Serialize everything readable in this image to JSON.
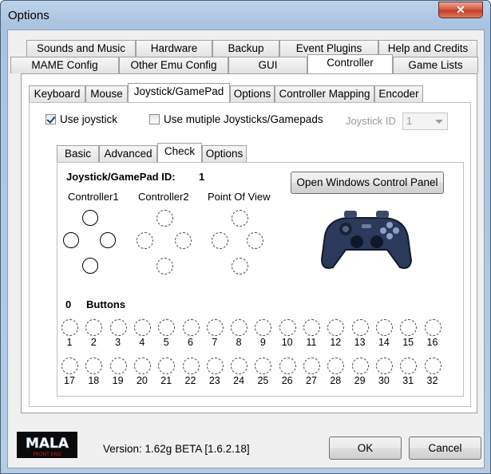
{
  "window": {
    "title": "Options",
    "close_glyph": "✕"
  },
  "top_tabs_row1": [
    "Sounds and Music",
    "Hardware",
    "Backup",
    "Event Plugins",
    "Help and Credits"
  ],
  "top_tabs_row2": [
    "MAME Config",
    "Other Emu Config",
    "GUI",
    "Controller",
    "Game Lists"
  ],
  "active_top_tab": "Controller",
  "sub_tabs": [
    "Keyboard",
    "Mouse",
    "Joystick/GamePad",
    "Options",
    "Controller Mapping",
    "Encoder"
  ],
  "active_sub_tab": "Joystick/GamePad",
  "use_joystick": {
    "label": "Use joystick",
    "checked": true
  },
  "use_multiple": {
    "label": "Use mutiple Joysticks/Gamepads",
    "checked": false
  },
  "joystick_id": {
    "label": "Joystick ID",
    "value": "1"
  },
  "inner_tabs": [
    "Basic",
    "Advanced",
    "Check",
    "Options"
  ],
  "active_inner_tab": "Check",
  "check": {
    "id_label": "Joystick/GamePad ID:",
    "id_value": "1",
    "open_panel_button": "Open Windows Control Panel",
    "controller1": "Controller1",
    "controller2": "Controller2",
    "pov": "Point Of View",
    "button_count": "0",
    "buttons_label": "Buttons",
    "button_numbers": [
      "1",
      "2",
      "3",
      "4",
      "5",
      "6",
      "7",
      "8",
      "9",
      "10",
      "11",
      "12",
      "13",
      "14",
      "15",
      "16",
      "17",
      "18",
      "19",
      "20",
      "21",
      "22",
      "23",
      "24",
      "25",
      "26",
      "27",
      "28",
      "29",
      "30",
      "31",
      "32"
    ]
  },
  "footer": {
    "logo_text": "MALA",
    "logo_subtext": "FRONT END",
    "version": "Version: 1.62g BETA [1.6.2.18]",
    "ok": "OK",
    "cancel": "Cancel"
  },
  "colors": {
    "title_bar": "#a9c4e0",
    "close_button": "#c23a23",
    "gamepad_body": "#2b3a5a"
  }
}
